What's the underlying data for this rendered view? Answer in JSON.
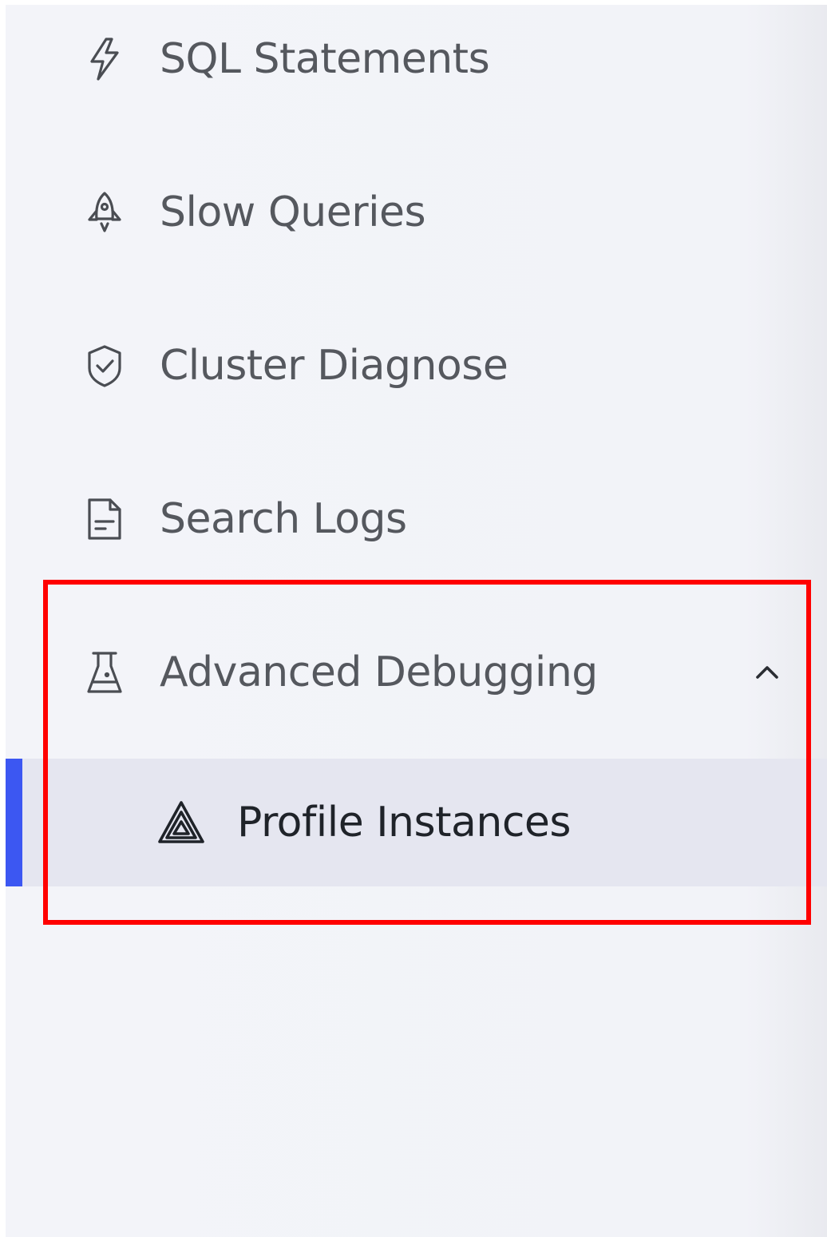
{
  "menu": {
    "items": [
      {
        "label": "SQL Statements",
        "icon": "lightning-icon"
      },
      {
        "label": "Slow Queries",
        "icon": "rocket-icon"
      },
      {
        "label": "Cluster Diagnose",
        "icon": "shield-check-icon"
      },
      {
        "label": "Search Logs",
        "icon": "document-icon"
      },
      {
        "label": "Advanced Debugging",
        "icon": "flask-icon",
        "expanded": true
      }
    ],
    "submenu": [
      {
        "label": "Profile Instances",
        "icon": "triangle-layers-icon",
        "active": true
      }
    ]
  },
  "colors": {
    "sidebar_bg": "#f3f4f9",
    "active_bg": "#e5e6f0",
    "active_bar": "#3c57f2",
    "highlight_border": "#ff0000"
  }
}
